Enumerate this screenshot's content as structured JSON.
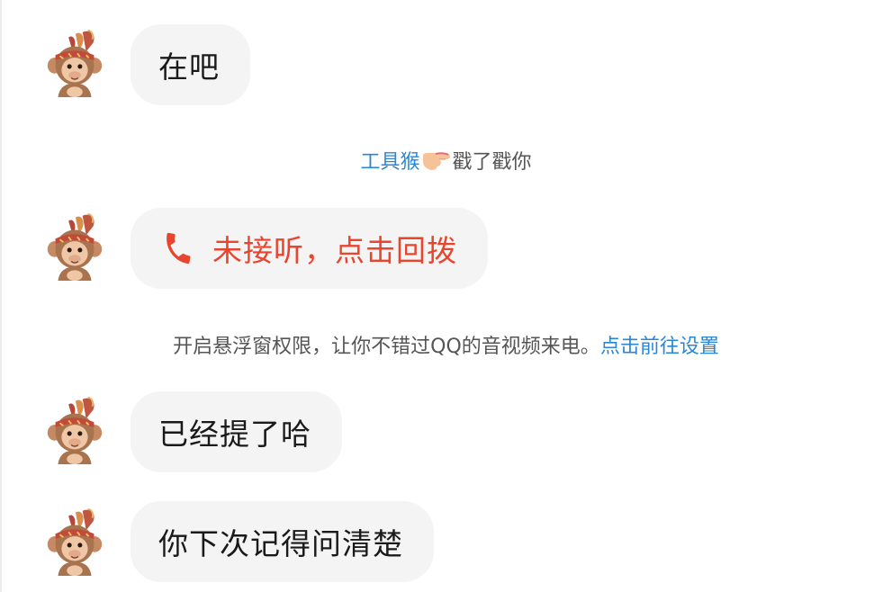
{
  "messages": [
    {
      "text": "在吧"
    },
    {
      "text": "未接听，点击回拨"
    },
    {
      "text": "已经提了哈"
    },
    {
      "text": "你下次记得问清楚"
    }
  ],
  "poke": {
    "sender": "工具猴",
    "action": "戳了戳你"
  },
  "notice": {
    "text": "开启悬浮窗权限，让你不错过QQ的音视频来电。",
    "link": "点击前往设置"
  },
  "colors": {
    "link": "#2a86d6",
    "missed_call": "#e8452f",
    "bubble": "#f4f4f4"
  },
  "icons": {
    "avatar": "monkey-avatar-icon",
    "call": "phone-icon",
    "poke": "pointing-finger-icon"
  }
}
